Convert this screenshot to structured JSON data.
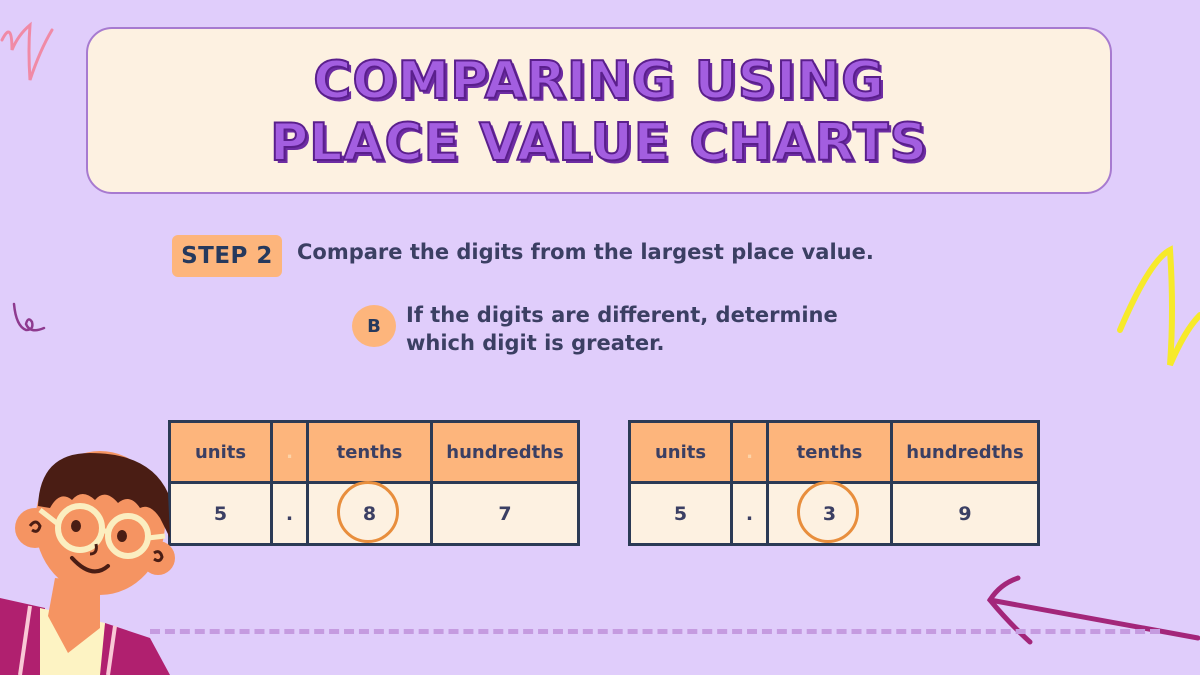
{
  "title": {
    "line1": "Comparing Using",
    "line2": "Place Value Charts"
  },
  "step": {
    "badge": "STEP 2",
    "text": "Compare the digits from the largest place value."
  },
  "sub_step": {
    "badge": "B",
    "text": "If the digits are different, determine which digit is greater."
  },
  "tables": [
    {
      "headers": [
        "units",
        ".",
        "tenths",
        "hundredths"
      ],
      "values": [
        "5",
        ".",
        "8",
        "7"
      ],
      "circled_column": "tenths"
    },
    {
      "headers": [
        "units",
        ".",
        "tenths",
        "hundredths"
      ],
      "values": [
        "5",
        ".",
        "3",
        "9"
      ],
      "circled_column": "tenths"
    }
  ],
  "colors": {
    "background": "#e0cdfb",
    "card": "#fdf1e1",
    "accent_orange": "#fdb57c",
    "title_purple": "#a35ee0",
    "ring_orange": "#e88e3d",
    "text_navy": "#2b3a55"
  },
  "decorations": [
    "pink-scribble",
    "purple-squiggle",
    "yellow-scribble",
    "magenta-arrow",
    "student-character"
  ]
}
